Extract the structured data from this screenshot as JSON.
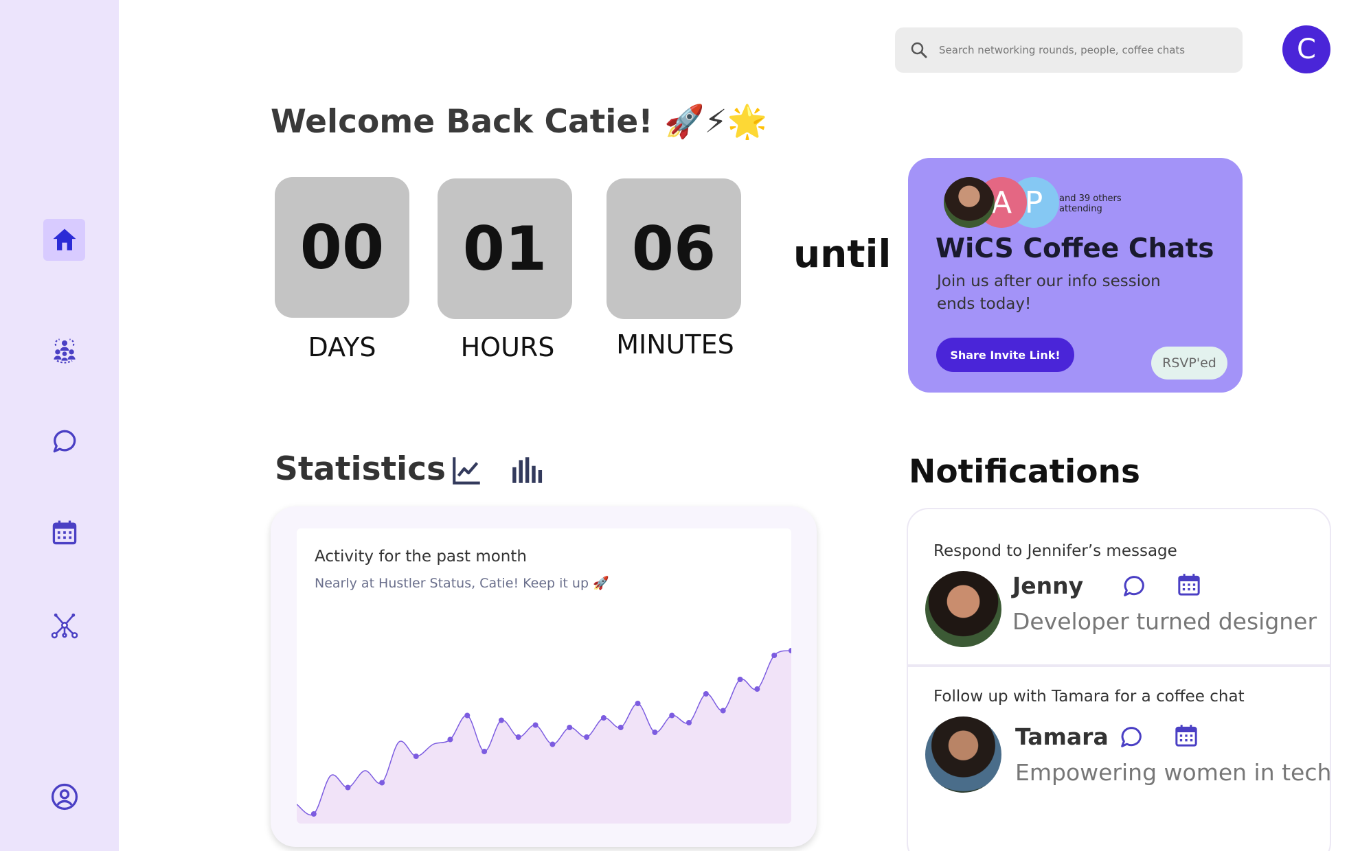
{
  "sidebar": {
    "items": [
      {
        "name": "home",
        "icon": "home-icon",
        "active": true
      },
      {
        "name": "community",
        "icon": "people-group-icon"
      },
      {
        "name": "messages",
        "icon": "chat-bubble-icon"
      },
      {
        "name": "calendar",
        "icon": "calendar-icon"
      },
      {
        "name": "network",
        "icon": "network-graph-icon"
      },
      {
        "name": "profile",
        "icon": "user-circle-icon"
      }
    ]
  },
  "header": {
    "search_placeholder": "Search networking rounds, people, coffee chats",
    "avatar_initial": "C"
  },
  "welcome": {
    "text": "Welcome Back Catie! 🚀⚡🌟"
  },
  "countdown": {
    "days": "00",
    "hours": "01",
    "minutes": "06",
    "days_label": "DAYS",
    "hours_label": "HOURS",
    "minutes_label": "MINUTES",
    "until": "until"
  },
  "event": {
    "attendee_initials": [
      "A",
      "P"
    ],
    "attending_text": "and 39 others attending",
    "title": "WiCS Coffee Chats",
    "description": "Join us after our info session ends today!",
    "share_button": "Share Invite Link!",
    "status": "RSVP'ed",
    "colors": {
      "card": "#a393f8",
      "button": "#4a25d8",
      "attendee_a": "#e46783",
      "attendee_p": "#85c8f3"
    }
  },
  "statistics": {
    "title": "Statistics",
    "chart_title": "Activity for the past month",
    "chart_subtitle": "Nearly at Hustler Status, Catie! Keep it up 🚀"
  },
  "chart_data": {
    "type": "area",
    "title": "Activity for the past month",
    "x": [
      1,
      2,
      3,
      4,
      5,
      6,
      7,
      8,
      9,
      10,
      11,
      12,
      13,
      14,
      15,
      16,
      17,
      18,
      19,
      20,
      21,
      22,
      23,
      24,
      25,
      26,
      27,
      28,
      29,
      30
    ],
    "values": [
      8,
      4,
      20,
      15,
      22,
      17,
      34,
      28,
      33,
      35,
      45,
      30,
      43,
      36,
      41,
      33,
      40,
      36,
      44,
      40,
      50,
      38,
      45,
      42,
      54,
      47,
      60,
      56,
      70,
      72
    ],
    "ylim": [
      0,
      80
    ],
    "grid": false,
    "color": "#7c5ce0",
    "fill": "#f1e3f8"
  },
  "notifications": {
    "title": "Notifications",
    "items": [
      {
        "prompt": "Respond to Jennifer’s message",
        "name": "Jenny",
        "bio": "Developer turned designer"
      },
      {
        "prompt": "Follow up with Tamara for a coffee chat",
        "name": "Tamara",
        "bio": "Empowering women in tech"
      }
    ]
  }
}
